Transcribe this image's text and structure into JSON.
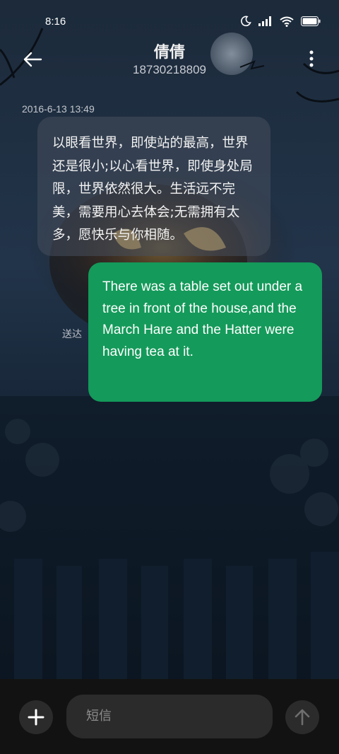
{
  "status_bar": {
    "time": "8:16",
    "icons": [
      "moon-icon",
      "signal-icon",
      "wifi-icon",
      "battery-icon"
    ]
  },
  "header": {
    "contact_name": "倩倩",
    "contact_number": "18730218809",
    "back_icon": "arrow-left-icon",
    "more_icon": "more-vertical-icon"
  },
  "conversation": {
    "timestamp": "2016-6-13 13:49",
    "messages": [
      {
        "direction": "incoming",
        "text": "以眼看世界，即使站的最高，世界还是很小;以心看世界，即使身处局限，世界依然很大。生活远不完美，需要用心去体会;无需拥有太多，愿快乐与你相随。"
      },
      {
        "direction": "outgoing",
        "text": "There was a table set out under a tree in front of the house,and the March Hare and the Hatter were having tea at it.",
        "status": "送达"
      }
    ]
  },
  "composer": {
    "placeholder": "短信",
    "add_icon": "plus-icon",
    "send_icon": "arrow-up-icon"
  },
  "colors": {
    "outgoing_bubble": "#149a5a",
    "incoming_bubble": "#464e5c",
    "bottom_bar": "#121212"
  }
}
